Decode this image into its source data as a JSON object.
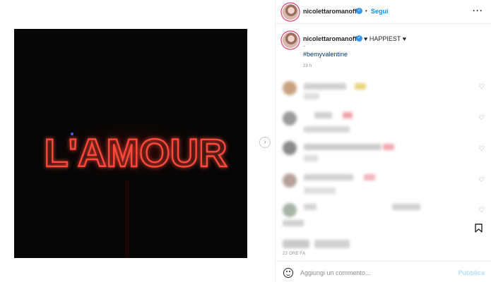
{
  "post": {
    "image_text": "L'AMOUR",
    "neon_color": "#ff3b2f"
  },
  "header": {
    "username": "nicolettaromanoff",
    "separator": "•",
    "follow_label": "Segui",
    "more_label": "···"
  },
  "caption": {
    "username": "nicolettaromanoff",
    "text": "♥ HAPPIEST ♥",
    "line2": "-",
    "hashtag": "#bemyvalentine",
    "time": "23 h"
  },
  "comments": [
    {
      "blurred": true,
      "heart": "♡"
    },
    {
      "blurred": true,
      "heart": "♡"
    },
    {
      "blurred": true,
      "heart": "♡"
    },
    {
      "blurred": true,
      "heart": "♡"
    },
    {
      "blurred": true,
      "heart": "♡"
    }
  ],
  "footer": {
    "timestamp": "23 ORE FA",
    "comment_placeholder": "Aggiungi un commento...",
    "publish_label": "Pubblica"
  },
  "icons": {
    "verified": "verified-badge-icon",
    "heart": "heart-outline-icon",
    "bookmark": "bookmark-icon",
    "emoji": "emoji-icon",
    "next": "chevron-right-icon"
  },
  "colors": {
    "accent_blue": "#0095f6",
    "hashtag_blue": "#00376b",
    "verified_blue": "#3897f0",
    "muted_gray": "#8e8e8e"
  }
}
